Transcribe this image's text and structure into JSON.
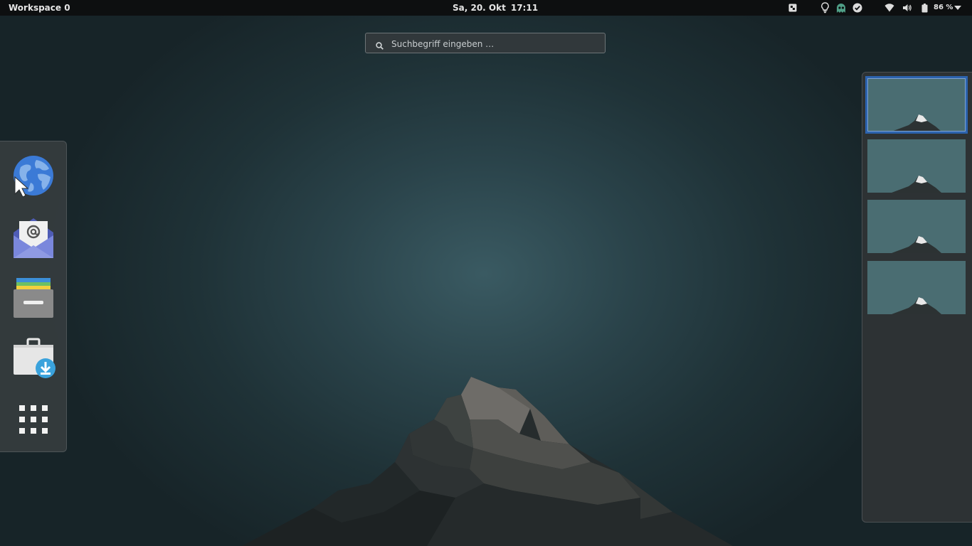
{
  "topbar": {
    "workspace_label": "Workspace 0",
    "date": "Sa, 20. Okt",
    "time": "17:11",
    "battery_percent": "86 %",
    "tray_icons": [
      "screenshot-icon",
      "lightbulb-icon",
      "ghost-icon",
      "check-circle-icon",
      "wifi-icon",
      "volume-icon",
      "battery-icon",
      "menu-arrow-icon"
    ]
  },
  "search": {
    "placeholder": "Suchbegriff eingeben …"
  },
  "dash": {
    "items": [
      {
        "icon": "web-browser-icon"
      },
      {
        "icon": "mail-icon"
      },
      {
        "icon": "files-icon"
      },
      {
        "icon": "software-center-icon"
      },
      {
        "icon": "show-applications-icon"
      }
    ]
  },
  "workspaces": {
    "count": 4,
    "active_index": 0
  },
  "colors": {
    "topbar": "#0d0f10",
    "accent": "#2c63ae",
    "dash_bg": "#363c3e"
  }
}
